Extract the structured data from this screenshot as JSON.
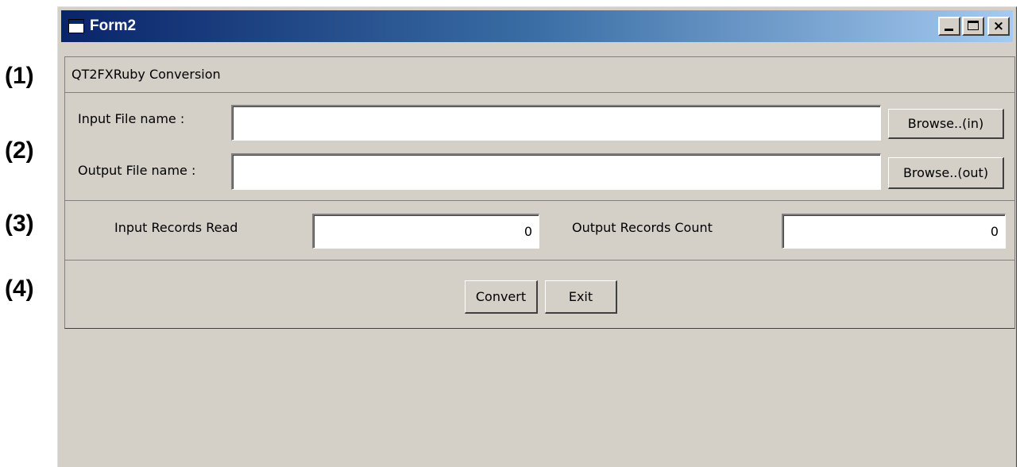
{
  "annotations": [
    "(1)",
    "(2)",
    "(3)",
    "(4)"
  ],
  "window": {
    "title": "Form2",
    "icon": "form-window-icon",
    "controls": [
      "minimize-icon",
      "maximize-icon",
      "close-icon"
    ],
    "close_glyph": "×"
  },
  "header": {
    "title": "QT2FXRuby Conversion"
  },
  "files": {
    "input_label": "Input File name :",
    "input_value": "",
    "browse_in_label": "Browse..(in)",
    "output_label": "Output File name :",
    "output_value": "",
    "browse_out_label": "Browse..(out)"
  },
  "counts": {
    "input_label": "Input Records Read",
    "input_value": "0",
    "output_label": "Output Records Count",
    "output_value": "0"
  },
  "actions": {
    "convert_label": "Convert",
    "exit_label": "Exit"
  },
  "colors": {
    "face": "#d4d0c8",
    "titlebar_start": "#0a246a",
    "titlebar_end": "#a6caf0"
  }
}
